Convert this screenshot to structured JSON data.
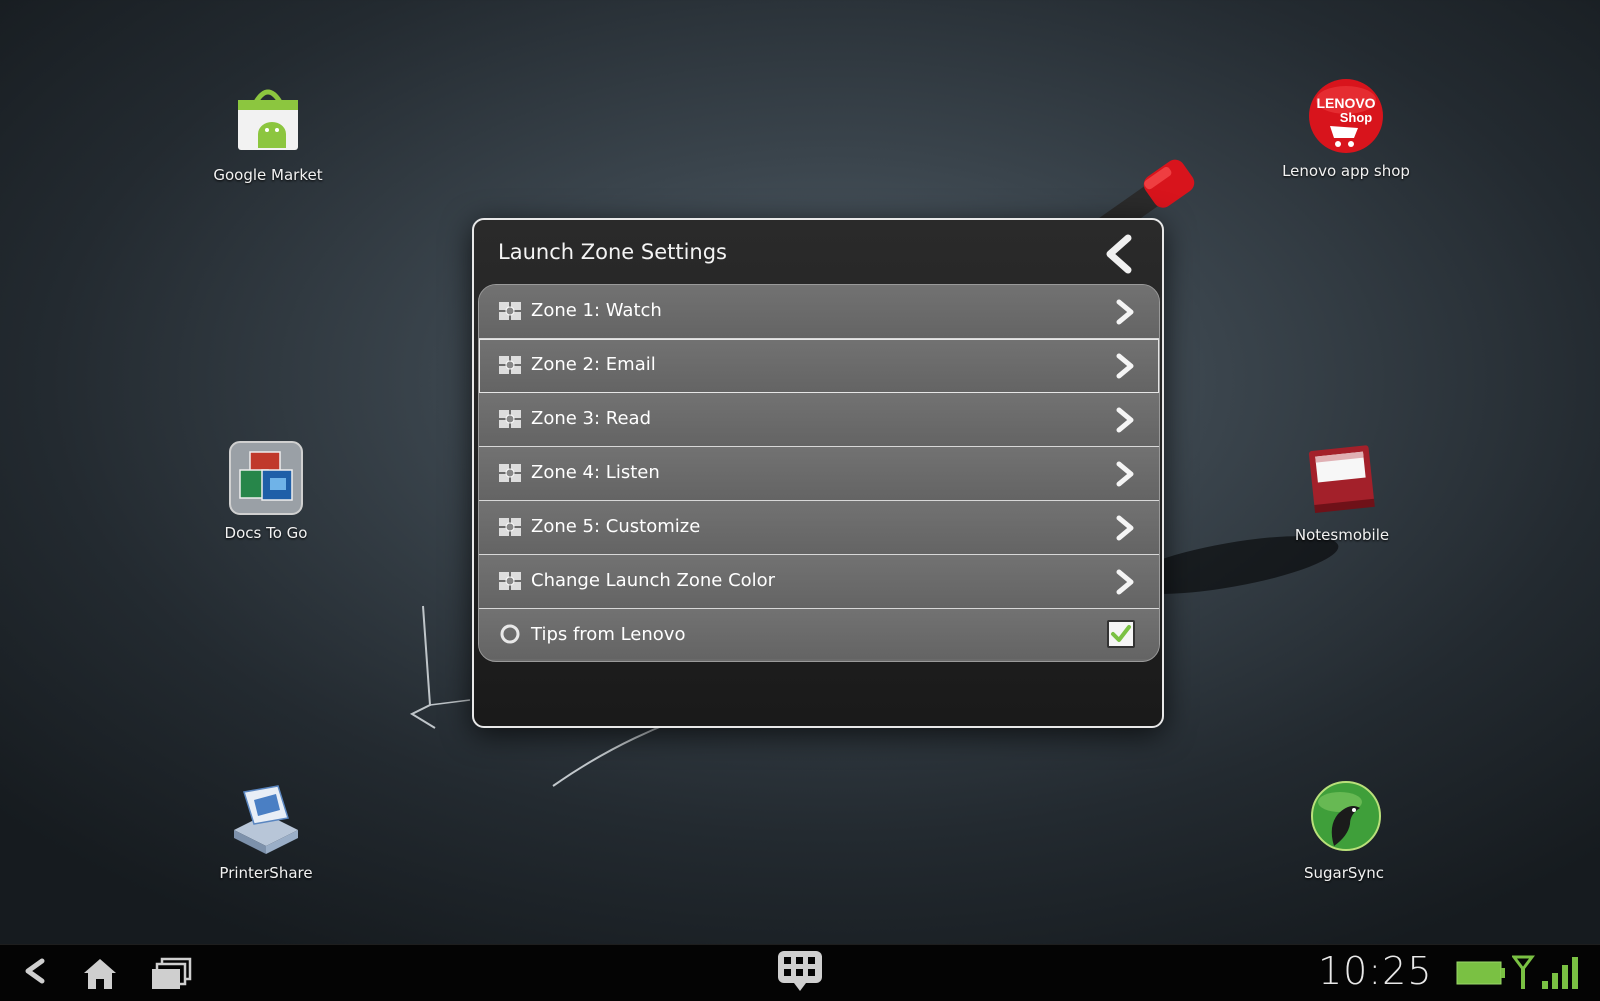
{
  "desktop": {
    "apps": [
      {
        "label": "Google Market",
        "icon": "google-market-icon"
      },
      {
        "label": "Lenovo app shop",
        "icon": "lenovo-shop-icon",
        "logo_text": [
          "LENOVO",
          "Shop"
        ]
      },
      {
        "label": "Docs To Go",
        "icon": "docs-to-go-icon"
      },
      {
        "label": "Notesmobile",
        "icon": "notesmobile-icon"
      },
      {
        "label": "PrinterShare",
        "icon": "printershare-icon"
      },
      {
        "label": "SugarSync",
        "icon": "sugarsync-icon"
      }
    ]
  },
  "dialog": {
    "title": "Launch Zone Settings",
    "items": [
      {
        "label": "Zone 1: Watch",
        "icon": "zone-icon",
        "control": "chevron"
      },
      {
        "label": "Zone 2: Email",
        "icon": "zone-icon",
        "control": "chevron",
        "selected": true
      },
      {
        "label": "Zone 3: Read",
        "icon": "zone-icon",
        "control": "chevron"
      },
      {
        "label": "Zone 4: Listen",
        "icon": "zone-icon",
        "control": "chevron"
      },
      {
        "label": "Zone 5: Customize",
        "icon": "zone-icon",
        "control": "chevron"
      },
      {
        "label": "Change Launch Zone Color",
        "icon": "zone-icon",
        "control": "chevron"
      },
      {
        "label": "Tips from Lenovo",
        "icon": "tips-circle-icon",
        "control": "checkbox",
        "checked": true
      }
    ]
  },
  "status_bar": {
    "time": "10:25",
    "battery": "battery-icon",
    "signal": "signal-icon"
  },
  "colors": {
    "accent_green": "#7ac143",
    "lenovo_red": "#d8141c",
    "dialog_row": "#6b6b6b"
  }
}
